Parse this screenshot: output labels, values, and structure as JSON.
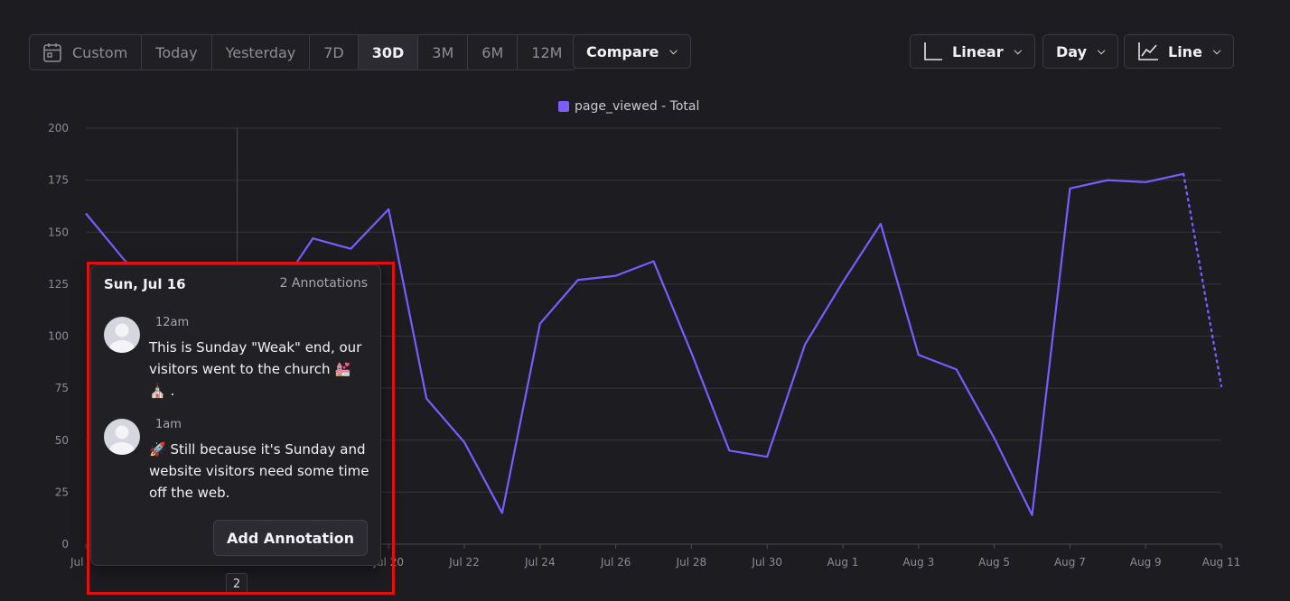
{
  "toolbar": {
    "ranges": [
      "Custom",
      "Today",
      "Yesterday",
      "7D",
      "30D",
      "3M",
      "6M",
      "12M"
    ],
    "active_range": "30D",
    "compare_label": "Compare",
    "scale_label": "Linear",
    "interval_label": "Day",
    "chart_type_label": "Line"
  },
  "legend": {
    "label": "page_viewed - Total",
    "color": "#7a5cff"
  },
  "chart_data": {
    "type": "line",
    "series": [
      {
        "name": "page_viewed - Total",
        "color": "#7a5cff",
        "x": [
          "Jul 12",
          "Jul 13",
          "Jul 14",
          "Jul 15",
          "Jul 16",
          "Jul 17",
          "Jul 18",
          "Jul 19",
          "Jul 20",
          "Jul 21",
          "Jul 22",
          "Jul 23",
          "Jul 24",
          "Jul 25",
          "Jul 26",
          "Jul 27",
          "Jul 28",
          "Jul 29",
          "Jul 30",
          "Jul 31",
          "Aug 1",
          "Aug 2",
          "Aug 3",
          "Aug 4",
          "Aug 5",
          "Aug 6",
          "Aug 7",
          "Aug 8",
          "Aug 9",
          "Aug 10",
          "Aug 11"
        ],
        "values": [
          159,
          137,
          118,
          108,
          100,
          120,
          147,
          142,
          161,
          70,
          49,
          15,
          106,
          127,
          129,
          136,
          92,
          45,
          42,
          96,
          126,
          154,
          91,
          84,
          51,
          14,
          171,
          175,
          174,
          178,
          76
        ],
        "partial_last": true
      }
    ],
    "ylim": [
      0,
      200
    ],
    "yticks": [
      0,
      25,
      50,
      75,
      100,
      125,
      150,
      175,
      200
    ],
    "xtick_labels": [
      "Jul 12",
      "Jul 14",
      "Jul 16",
      "Jul 18",
      "Jul 20",
      "Jul 22",
      "Jul 24",
      "Jul 26",
      "Jul 28",
      "Jul 30",
      "Aug 1",
      "Aug 3",
      "Aug 5",
      "Aug 7",
      "Aug 9",
      "Aug 11"
    ],
    "visible_xtick_labels": [
      "Jul",
      "Jul 20",
      "Jul 22",
      "Jul 24",
      "Jul 26",
      "Jul 28",
      "Jul 30",
      "Aug 1",
      "Aug 3",
      "Aug 5",
      "Aug 7",
      "Aug 9",
      "Aug 11"
    ],
    "hover_date": "Jul 16",
    "grid": true,
    "legend_position": "top"
  },
  "tooltip": {
    "date": "Sun, Jul 16",
    "count": "2 Annotations",
    "annotations": [
      {
        "time": "12am",
        "text": "This is Sunday \"Weak\" end, our visitors went to the church 💒 ⛪ ."
      },
      {
        "time": "1am",
        "text": "🚀 Still because it's Sunday and website visitors need some time off the web."
      }
    ],
    "add_button": "Add Annotation"
  },
  "badge": {
    "count": "2"
  },
  "colors": {
    "background": "#1c1c21",
    "accent": "#7a5cff",
    "highlight": "#e01010"
  }
}
